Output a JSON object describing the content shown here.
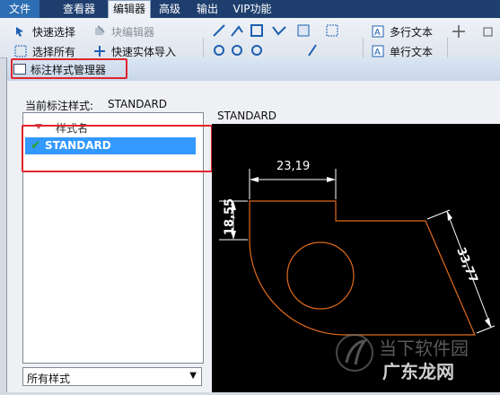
{
  "menubar": {
    "items": [
      {
        "label": "文件",
        "active": false
      },
      {
        "label": "查看器",
        "active": false
      },
      {
        "label": "编辑器",
        "active": true
      },
      {
        "label": "高级",
        "active": false
      },
      {
        "label": "输出",
        "active": false
      },
      {
        "label": "VIP功能",
        "active": false
      }
    ]
  },
  "ribbon": {
    "quick_select": "快速选择",
    "block_editor": "块编辑器",
    "select_all": "选择所有",
    "quick_import": "快速实体导入",
    "multiline_text": "多行文本",
    "single_line_text": "单行文本"
  },
  "dialog": {
    "title": "标注样式管理器",
    "current_style_label": "当前标注样式:",
    "current_style_value": "STANDARD",
    "list_header": "样式名",
    "styles": [
      "STANDARD"
    ],
    "preview_label": "STANDARD",
    "filter_value": "所有样式"
  },
  "preview": {
    "dim_horizontal": "23,19",
    "dim_vertical": "18,55",
    "dim_aligned": "33,77",
    "colors": {
      "geometry": "#e06a1c",
      "dimension": "#ffffff",
      "background": "#000000"
    }
  },
  "watermark": {
    "line1": "当下软件园",
    "line2": "广东龙网"
  },
  "colors": {
    "highlight": "#e0262b",
    "selection": "#3399ff",
    "menubar": "#1e3f6e"
  }
}
